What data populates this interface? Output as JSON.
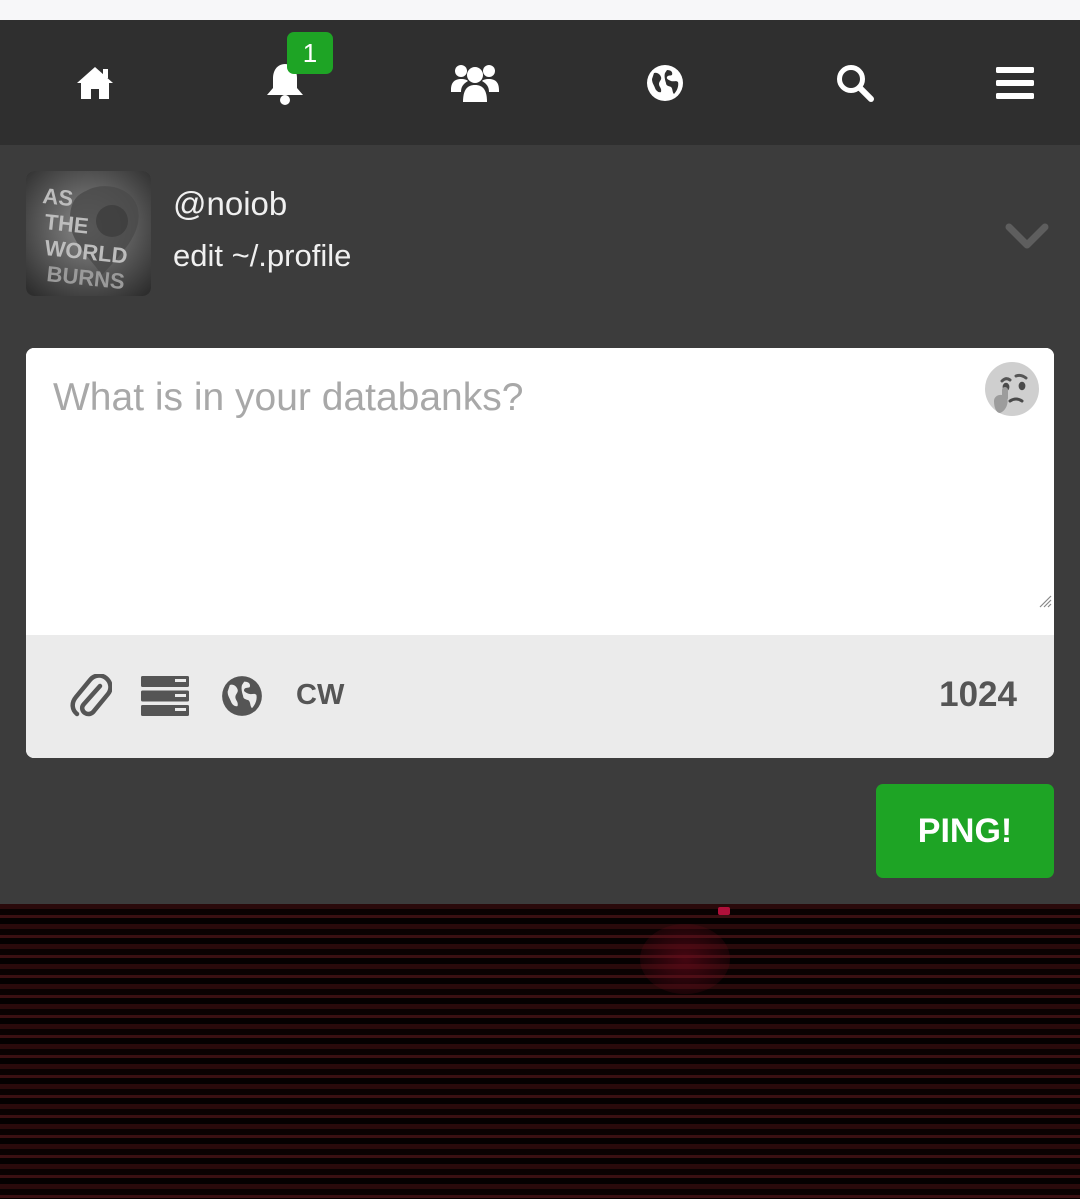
{
  "nav": {
    "items": [
      {
        "name": "home",
        "icon": "home-icon"
      },
      {
        "name": "notifications",
        "icon": "bell-icon"
      },
      {
        "name": "groups",
        "icon": "users-icon"
      },
      {
        "name": "network",
        "icon": "globe-icon"
      },
      {
        "name": "search",
        "icon": "search-icon"
      },
      {
        "name": "menu",
        "icon": "hamburger-menu-icon"
      }
    ],
    "notification_count": "1"
  },
  "profile": {
    "handle": "@noiob",
    "edit_link": "edit ~/.profile",
    "avatar_text": "AS THE WORLD BURNS"
  },
  "composer": {
    "placeholder": "What is in your databanks?",
    "emoji_icon": "thinking-face-icon",
    "cw_label": "CW",
    "char_remaining": "1024",
    "tools": [
      "paperclip-icon",
      "layout-icon",
      "globe-icon"
    ]
  },
  "submit": {
    "label": "PING!"
  },
  "colors": {
    "nav_bg": "#2f2f2f",
    "panel_bg": "#3c3c3c",
    "accent_green": "#1ea425",
    "toolbar_bg": "#ebebeb"
  }
}
